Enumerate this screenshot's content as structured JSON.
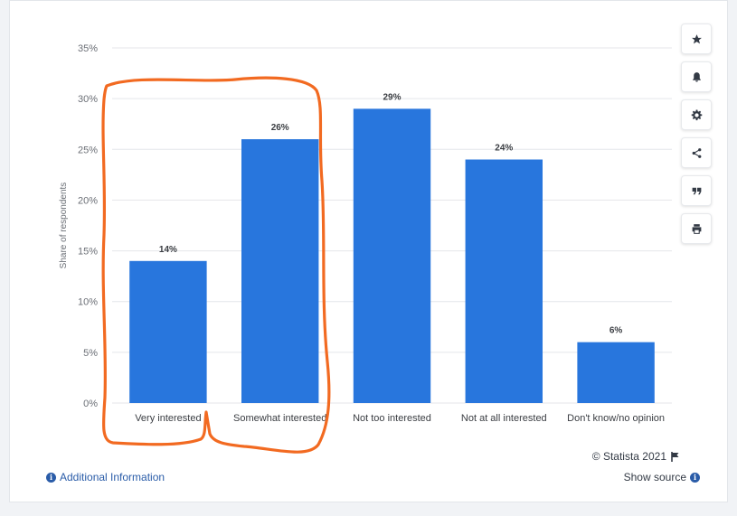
{
  "chart_data": {
    "type": "bar",
    "categories": [
      "Very interested",
      "Somewhat interested",
      "Not too interested",
      "Not at all interested",
      "Don't know/no opinion"
    ],
    "values": [
      14,
      26,
      29,
      24,
      6
    ],
    "data_labels": [
      "14%",
      "26%",
      "29%",
      "24%",
      "6%"
    ],
    "ylabel": "Share of respondents",
    "ylim": [
      0,
      35
    ],
    "yticks": [
      "0%",
      "5%",
      "10%",
      "15%",
      "20%",
      "25%",
      "30%",
      "35%"
    ],
    "grid": true,
    "bar_color": "#2876dd"
  },
  "footer": {
    "additional_info": "Additional Information",
    "show_source": "Show source",
    "copyright": "© Statista 2021"
  },
  "toolbar": {
    "icons": [
      "star-icon",
      "bell-icon",
      "gear-icon",
      "share-icon",
      "quote-icon",
      "print-icon"
    ]
  },
  "annotation": {
    "color": "#f26a21"
  }
}
